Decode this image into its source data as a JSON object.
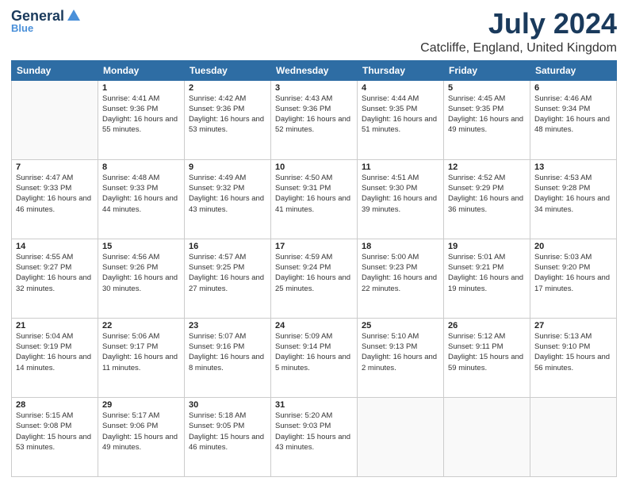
{
  "header": {
    "logo_general": "General",
    "logo_blue": "Blue",
    "title": "July 2024",
    "subtitle": "Catcliffe, England, United Kingdom"
  },
  "days_of_week": [
    "Sunday",
    "Monday",
    "Tuesday",
    "Wednesday",
    "Thursday",
    "Friday",
    "Saturday"
  ],
  "weeks": [
    [
      {
        "num": "",
        "sunrise": "",
        "sunset": "",
        "daylight": ""
      },
      {
        "num": "1",
        "sunrise": "Sunrise: 4:41 AM",
        "sunset": "Sunset: 9:36 PM",
        "daylight": "Daylight: 16 hours and 55 minutes."
      },
      {
        "num": "2",
        "sunrise": "Sunrise: 4:42 AM",
        "sunset": "Sunset: 9:36 PM",
        "daylight": "Daylight: 16 hours and 53 minutes."
      },
      {
        "num": "3",
        "sunrise": "Sunrise: 4:43 AM",
        "sunset": "Sunset: 9:36 PM",
        "daylight": "Daylight: 16 hours and 52 minutes."
      },
      {
        "num": "4",
        "sunrise": "Sunrise: 4:44 AM",
        "sunset": "Sunset: 9:35 PM",
        "daylight": "Daylight: 16 hours and 51 minutes."
      },
      {
        "num": "5",
        "sunrise": "Sunrise: 4:45 AM",
        "sunset": "Sunset: 9:35 PM",
        "daylight": "Daylight: 16 hours and 49 minutes."
      },
      {
        "num": "6",
        "sunrise": "Sunrise: 4:46 AM",
        "sunset": "Sunset: 9:34 PM",
        "daylight": "Daylight: 16 hours and 48 minutes."
      }
    ],
    [
      {
        "num": "7",
        "sunrise": "Sunrise: 4:47 AM",
        "sunset": "Sunset: 9:33 PM",
        "daylight": "Daylight: 16 hours and 46 minutes."
      },
      {
        "num": "8",
        "sunrise": "Sunrise: 4:48 AM",
        "sunset": "Sunset: 9:33 PM",
        "daylight": "Daylight: 16 hours and 44 minutes."
      },
      {
        "num": "9",
        "sunrise": "Sunrise: 4:49 AM",
        "sunset": "Sunset: 9:32 PM",
        "daylight": "Daylight: 16 hours and 43 minutes."
      },
      {
        "num": "10",
        "sunrise": "Sunrise: 4:50 AM",
        "sunset": "Sunset: 9:31 PM",
        "daylight": "Daylight: 16 hours and 41 minutes."
      },
      {
        "num": "11",
        "sunrise": "Sunrise: 4:51 AM",
        "sunset": "Sunset: 9:30 PM",
        "daylight": "Daylight: 16 hours and 39 minutes."
      },
      {
        "num": "12",
        "sunrise": "Sunrise: 4:52 AM",
        "sunset": "Sunset: 9:29 PM",
        "daylight": "Daylight: 16 hours and 36 minutes."
      },
      {
        "num": "13",
        "sunrise": "Sunrise: 4:53 AM",
        "sunset": "Sunset: 9:28 PM",
        "daylight": "Daylight: 16 hours and 34 minutes."
      }
    ],
    [
      {
        "num": "14",
        "sunrise": "Sunrise: 4:55 AM",
        "sunset": "Sunset: 9:27 PM",
        "daylight": "Daylight: 16 hours and 32 minutes."
      },
      {
        "num": "15",
        "sunrise": "Sunrise: 4:56 AM",
        "sunset": "Sunset: 9:26 PM",
        "daylight": "Daylight: 16 hours and 30 minutes."
      },
      {
        "num": "16",
        "sunrise": "Sunrise: 4:57 AM",
        "sunset": "Sunset: 9:25 PM",
        "daylight": "Daylight: 16 hours and 27 minutes."
      },
      {
        "num": "17",
        "sunrise": "Sunrise: 4:59 AM",
        "sunset": "Sunset: 9:24 PM",
        "daylight": "Daylight: 16 hours and 25 minutes."
      },
      {
        "num": "18",
        "sunrise": "Sunrise: 5:00 AM",
        "sunset": "Sunset: 9:23 PM",
        "daylight": "Daylight: 16 hours and 22 minutes."
      },
      {
        "num": "19",
        "sunrise": "Sunrise: 5:01 AM",
        "sunset": "Sunset: 9:21 PM",
        "daylight": "Daylight: 16 hours and 19 minutes."
      },
      {
        "num": "20",
        "sunrise": "Sunrise: 5:03 AM",
        "sunset": "Sunset: 9:20 PM",
        "daylight": "Daylight: 16 hours and 17 minutes."
      }
    ],
    [
      {
        "num": "21",
        "sunrise": "Sunrise: 5:04 AM",
        "sunset": "Sunset: 9:19 PM",
        "daylight": "Daylight: 16 hours and 14 minutes."
      },
      {
        "num": "22",
        "sunrise": "Sunrise: 5:06 AM",
        "sunset": "Sunset: 9:17 PM",
        "daylight": "Daylight: 16 hours and 11 minutes."
      },
      {
        "num": "23",
        "sunrise": "Sunrise: 5:07 AM",
        "sunset": "Sunset: 9:16 PM",
        "daylight": "Daylight: 16 hours and 8 minutes."
      },
      {
        "num": "24",
        "sunrise": "Sunrise: 5:09 AM",
        "sunset": "Sunset: 9:14 PM",
        "daylight": "Daylight: 16 hours and 5 minutes."
      },
      {
        "num": "25",
        "sunrise": "Sunrise: 5:10 AM",
        "sunset": "Sunset: 9:13 PM",
        "daylight": "Daylight: 16 hours and 2 minutes."
      },
      {
        "num": "26",
        "sunrise": "Sunrise: 5:12 AM",
        "sunset": "Sunset: 9:11 PM",
        "daylight": "Daylight: 15 hours and 59 minutes."
      },
      {
        "num": "27",
        "sunrise": "Sunrise: 5:13 AM",
        "sunset": "Sunset: 9:10 PM",
        "daylight": "Daylight: 15 hours and 56 minutes."
      }
    ],
    [
      {
        "num": "28",
        "sunrise": "Sunrise: 5:15 AM",
        "sunset": "Sunset: 9:08 PM",
        "daylight": "Daylight: 15 hours and 53 minutes."
      },
      {
        "num": "29",
        "sunrise": "Sunrise: 5:17 AM",
        "sunset": "Sunset: 9:06 PM",
        "daylight": "Daylight: 15 hours and 49 minutes."
      },
      {
        "num": "30",
        "sunrise": "Sunrise: 5:18 AM",
        "sunset": "Sunset: 9:05 PM",
        "daylight": "Daylight: 15 hours and 46 minutes."
      },
      {
        "num": "31",
        "sunrise": "Sunrise: 5:20 AM",
        "sunset": "Sunset: 9:03 PM",
        "daylight": "Daylight: 15 hours and 43 minutes."
      },
      {
        "num": "",
        "sunrise": "",
        "sunset": "",
        "daylight": ""
      },
      {
        "num": "",
        "sunrise": "",
        "sunset": "",
        "daylight": ""
      },
      {
        "num": "",
        "sunrise": "",
        "sunset": "",
        "daylight": ""
      }
    ]
  ]
}
